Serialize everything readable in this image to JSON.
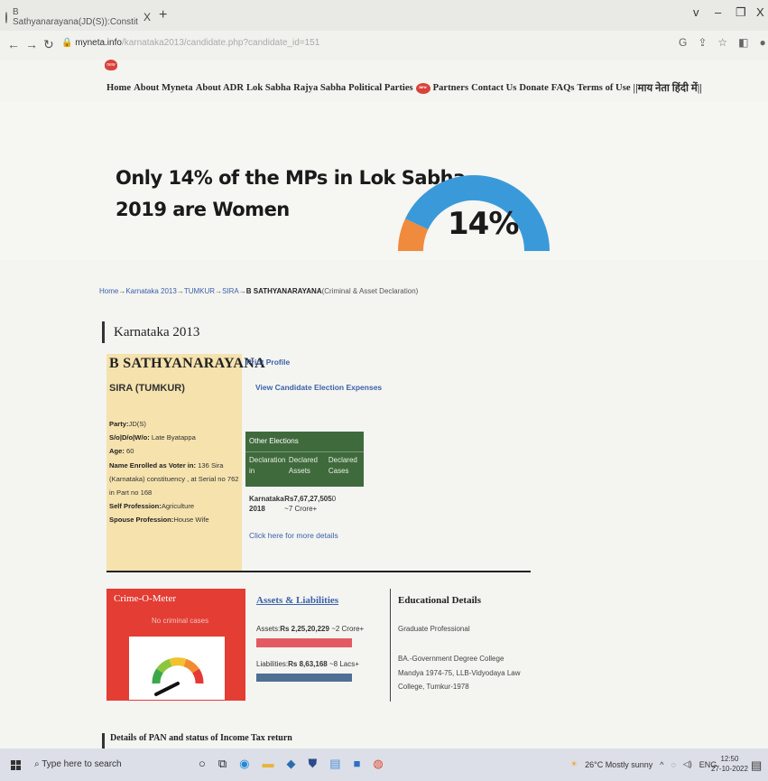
{
  "browser": {
    "tab_title": "B Sathyanarayana(JD(S)):Constit",
    "tab_close": "X",
    "new_tab": "+",
    "window_controls": [
      "v",
      "–",
      "❐",
      "X"
    ],
    "url_host": "myneta.info",
    "url_path": "/karnataka2013/candidate.php?candidate_id=151"
  },
  "nav": {
    "items": [
      "Home",
      "About Myneta",
      "About ADR",
      "Lok Sabha",
      "Rajya Sabha",
      "Political Parties"
    ],
    "items2": [
      "Partners",
      "Contact Us",
      "Donate",
      "FAQs",
      "Terms of Use"
    ],
    "hindi_link": "||माय नेता हिंदी में||"
  },
  "banner": {
    "line1": "Only 14% of the MPs in Lok Sabha",
    "line2": "2019 are Women",
    "percent_text": "14%",
    "women_share": 0.14,
    "colors": {
      "women": "#f08a3c",
      "men": "#3a9ad9"
    }
  },
  "breadcrumb": {
    "home": "Home",
    "election": "Karnataka 2013",
    "district": "TUMKUR",
    "constituency": "SIRA",
    "candidate": "B SATHYANARAYANA",
    "suffix": "(Criminal & Asset Declaration)",
    "sep": "→"
  },
  "section_title": "Karnataka 2013",
  "candidate": {
    "name": "B SATHYANARAYANA",
    "constituency": "SIRA (TUMKUR)",
    "party_label": "Party:",
    "party": "JD(S)",
    "relation_label": "S/o|D/o|W/o:",
    "relation": "Late Byatappa",
    "age_label": "Age:",
    "age": "60",
    "voter_label": "Name Enrolled as Voter in:",
    "voter": "136 Sira (Karnataka) constituency , at Serial no 762 in Part no 168",
    "profession_label": "Self Profession:",
    "profession": "Agriculture",
    "spouse_label": "Spouse Profession:",
    "spouse": "House Wife"
  },
  "links": {
    "print_profile": "Print Profile",
    "expenses": "View Candidate Election Expenses",
    "more_details": "Click here for more details"
  },
  "other_elections": {
    "title": "Other Elections",
    "columns": [
      "Declaration in",
      "Declared Assets",
      "Declared Cases"
    ],
    "rows": [
      {
        "declaration": "Karnataka 2018",
        "assets": "Rs7,67,27,505",
        "assets_approx": "~7 Crore+",
        "cases": "0"
      }
    ]
  },
  "crime_meter": {
    "title": "Crime-O-Meter",
    "subtitle": "No criminal cases"
  },
  "assets": {
    "title": "Assets & Liabilities",
    "assets_label": "Assets:",
    "assets_value": "Rs 2,25,20,229",
    "assets_approx": "~2 Crore+",
    "liabilities_label": "Liabilities:",
    "liabilities_value": "Rs 8,63,168",
    "liabilities_approx": "~8 Lacs+"
  },
  "education": {
    "title": "Educational Details",
    "category": "Graduate Professional",
    "detail": "BA.-Government Degree College Mandya 1974-75, LLB-Vidyodaya Law College, Tumkur-1978"
  },
  "next_section": "Details of PAN and status of Income Tax return",
  "taskbar": {
    "search_placeholder": "Type here to search",
    "weather": "26°C  Mostly sunny",
    "lang": "ENG",
    "time": "12:50",
    "date": "27-10-2022"
  }
}
